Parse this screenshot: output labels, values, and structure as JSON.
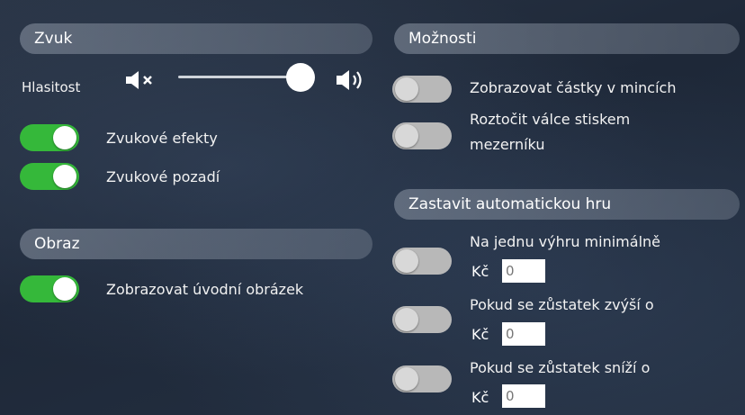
{
  "sound": {
    "header": "Zvuk",
    "volume_label": "Hlasitost",
    "volume_level": 0.86,
    "toggles": [
      {
        "label": "Zvukové efekty",
        "on": true
      },
      {
        "label": "Zvukové pozadí",
        "on": true
      }
    ]
  },
  "image": {
    "header": "Obraz",
    "toggles": [
      {
        "label": "Zobrazovat úvodní obrázek",
        "on": true
      }
    ]
  },
  "options": {
    "header": "Možnosti",
    "toggles": [
      {
        "label": "Zobrazovat částky v mincích",
        "on": false
      },
      {
        "label_line1": "Roztočit válce stiskem",
        "label_line2": "mezerníku",
        "on": false
      }
    ]
  },
  "autoplay": {
    "header": "Zastavit automatickou hru",
    "currency": "Kč",
    "items": [
      {
        "label": "Na jednu výhru minimálně",
        "value": "0",
        "on": false
      },
      {
        "label": "Pokud se zůstatek zvýší o",
        "value": "0",
        "on": false
      },
      {
        "label": "Pokud se zůstatek sníží o",
        "value": "0",
        "on": false
      }
    ]
  },
  "colors": {
    "toggle_on": "#35b83a",
    "toggle_off": "#b8b8b8"
  }
}
